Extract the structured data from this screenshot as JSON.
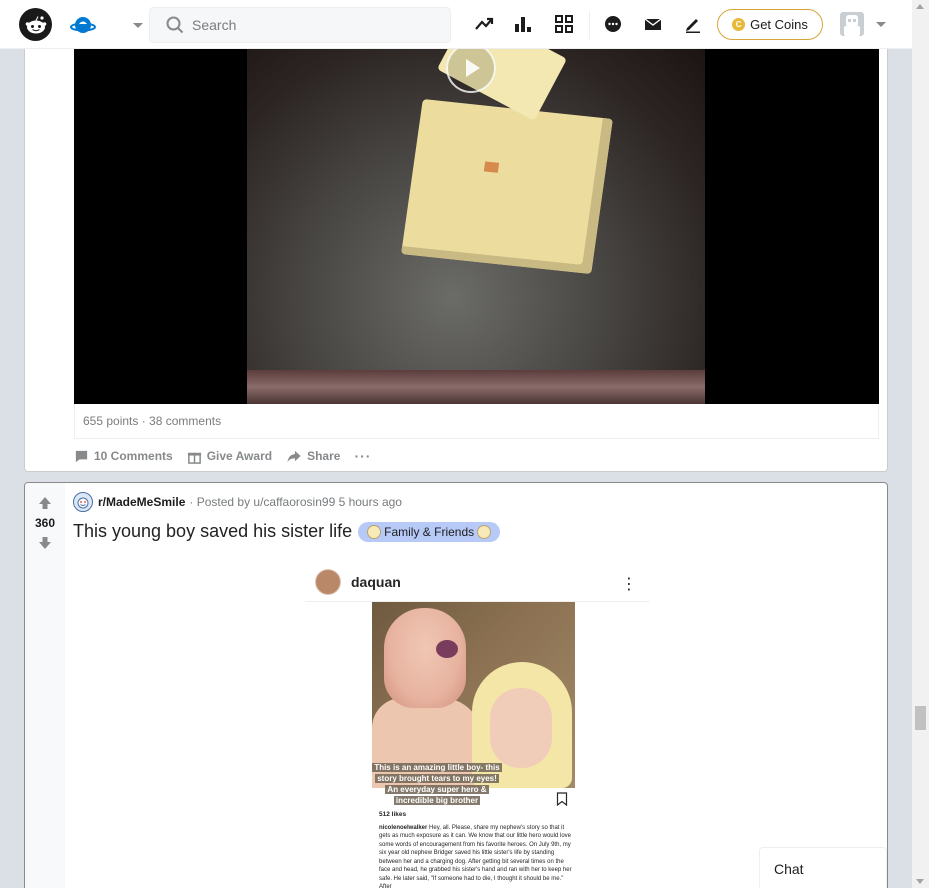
{
  "header": {
    "search_placeholder": "Search",
    "get_coins_label": "Get Coins",
    "coin_symbol": "C",
    "icons": [
      "popular-icon",
      "stats-icon",
      "rpan-icon",
      "chat-icon",
      "mail-icon",
      "create-post-icon"
    ]
  },
  "post1": {
    "meta": "655 points · 38 comments",
    "comments_label": "10 Comments",
    "award_label": "Give Award",
    "share_label": "Share",
    "more_label": "···"
  },
  "post2": {
    "votes": "360",
    "subreddit": "r/MadeMeSmile",
    "posted_by": "· Posted by u/caffaorosin99 5 hours ago",
    "title": "This young boy saved his sister life",
    "flair": "Family & Friends",
    "embed": {
      "username": "daquan",
      "caption_line1": "This is an amazing little boy- this",
      "caption_line2": "story brought tears to my eyes!",
      "caption_line3": "An everyday super hero &",
      "caption_line4": "incredible big brother",
      "likes": "512 likes",
      "body_user": "nicolenoelwalker",
      "body_text": " Hey, all.  Please, share my nephew's story so that it gets as much exposure as it can.  We know that our little hero would love some words of encouragement from his favorite heroes. On July 9th, my six year old nephew Bridger saved his little sister's life by standing between her and a charging dog.  After getting bit several times on the face and head, he grabbed his sister's hand and ran with her to keep her safe.  He later said, \"If someone had to die, I thought it should be me.\" After"
    }
  },
  "chat": {
    "label": "Chat"
  },
  "colors": {
    "page_bg": "#dae0e6",
    "coin_border": "#d7a53a",
    "flair_bg": "#b7c9f7"
  }
}
